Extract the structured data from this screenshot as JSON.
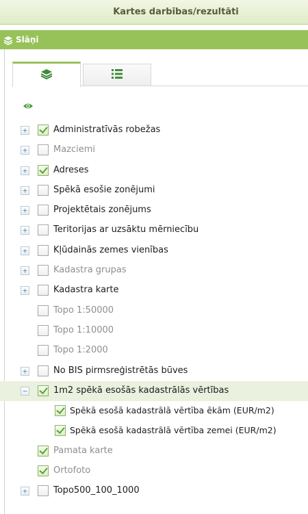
{
  "header": {
    "title": "Kartes darbības/rezultāti"
  },
  "layers_panel": {
    "title": "Slāņi",
    "icon": "layers-icon"
  },
  "tabs": [
    {
      "name": "layers",
      "icon": "layers-icon",
      "active": true
    },
    {
      "name": "legend",
      "icon": "list-icon",
      "active": false
    }
  ],
  "visibility_icon": "eye-icon",
  "layers": [
    {
      "label": "Administratīvās robežas",
      "checked": true,
      "disabled": false,
      "expander": "+",
      "level": 1,
      "highlight": false
    },
    {
      "label": "Mazciemi",
      "checked": false,
      "disabled": true,
      "expander": "+",
      "level": 1,
      "highlight": false
    },
    {
      "label": "Adreses",
      "checked": true,
      "disabled": false,
      "expander": "+",
      "level": 1,
      "highlight": false
    },
    {
      "label": "Spēkā esošie zonējumi",
      "checked": false,
      "disabled": false,
      "expander": "+",
      "level": 1,
      "highlight": false
    },
    {
      "label": "Projektētais zonējums",
      "checked": false,
      "disabled": false,
      "expander": "+",
      "level": 1,
      "highlight": false
    },
    {
      "label": "Teritorijas ar uzsāktu mērniecību",
      "checked": false,
      "disabled": false,
      "expander": "+",
      "level": 1,
      "highlight": false
    },
    {
      "label": "Kļūdainās zemes vienības",
      "checked": false,
      "disabled": false,
      "expander": "+",
      "level": 1,
      "highlight": false
    },
    {
      "label": "Kadastra grupas",
      "checked": false,
      "disabled": true,
      "expander": "+",
      "level": 1,
      "highlight": false
    },
    {
      "label": "Kadastra karte",
      "checked": false,
      "disabled": false,
      "expander": "+",
      "level": 1,
      "highlight": false
    },
    {
      "label": "Topo 1:50000",
      "checked": false,
      "disabled": true,
      "expander": null,
      "level": 1,
      "highlight": false
    },
    {
      "label": "Topo 1:10000",
      "checked": false,
      "disabled": true,
      "expander": null,
      "level": 1,
      "highlight": false
    },
    {
      "label": "Topo 1:2000",
      "checked": false,
      "disabled": true,
      "expander": null,
      "level": 1,
      "highlight": false
    },
    {
      "label": "No BIS pirmsreģistrētās būves",
      "checked": false,
      "disabled": false,
      "expander": "+",
      "level": 1,
      "highlight": false
    },
    {
      "label": "1m2 spēkā esošās kadastrālās vērtības",
      "checked": true,
      "disabled": false,
      "expander": "−",
      "level": 1,
      "highlight": true
    },
    {
      "label": "Spēkā esošā kadastrālā vērtība ēkām (EUR/m2)",
      "checked": true,
      "disabled": false,
      "expander": null,
      "level": 2,
      "highlight": false
    },
    {
      "label": "Spēkā esošā kadastrālā vērtība zemei (EUR/m2)",
      "checked": true,
      "disabled": false,
      "expander": null,
      "level": 2,
      "highlight": false
    },
    {
      "label": "Pamata karte",
      "checked": true,
      "disabled": true,
      "expander": null,
      "level": 1,
      "highlight": false
    },
    {
      "label": "Ortofoto",
      "checked": true,
      "disabled": true,
      "expander": null,
      "level": 1,
      "highlight": false
    },
    {
      "label": "Topo500_100_1000",
      "checked": false,
      "disabled": false,
      "expander": "+",
      "level": 1,
      "highlight": false
    }
  ]
}
